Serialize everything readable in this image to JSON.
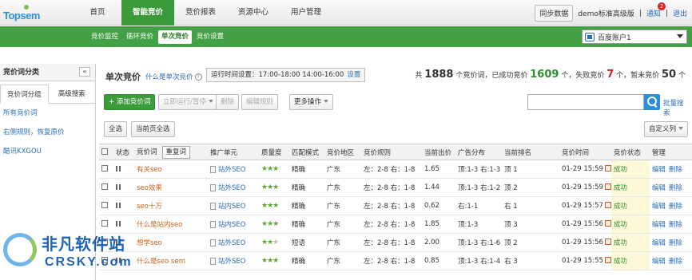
{
  "app": {
    "logo_text": "Topsem"
  },
  "nav": {
    "items": [
      "首页",
      "智能竞价",
      "竞价报表",
      "资源中心",
      "用户管理"
    ],
    "active_index": 1
  },
  "topright": {
    "sync_label": "同步数据",
    "user_label": "demo标准高级版",
    "notice_label": "通知",
    "notice_count": "2",
    "logout_label": "退出"
  },
  "subnav": {
    "items": [
      "竞价监控",
      "循环竞价",
      "单次竞价",
      "竞价设置"
    ],
    "active_index": 2
  },
  "account_select": {
    "value": "百度账户1"
  },
  "sidebar": {
    "title": "竞价词分类",
    "collapse_glyph": "«",
    "tabs": [
      "竞价词分组",
      "高级搜索"
    ],
    "links": [
      "所有竞价词",
      "右侧规则，恢复原价",
      "酷讯KXGOU"
    ]
  },
  "main": {
    "title": "单次竞价",
    "what_link": "什么是单次竞价",
    "info_glyph": "?",
    "time_label": "运行时间设置：17:00-18:00 14:00-16:00",
    "time_setting": "设置",
    "stats": {
      "prefix": "共",
      "total": "1888",
      "t1": "个竞价词，已成功竞价",
      "success": "1609",
      "t2": "个，失败竞价",
      "fail": "7",
      "t3": "个，暂未竞价",
      "pending": "50",
      "t4": "个"
    }
  },
  "toolbar": {
    "add_label": "+ 添加竞价词",
    "run_label": "立即运行/暂停",
    "delete_label": "删除",
    "edit_rule_label": "编辑规则",
    "more_label": "更多操作",
    "search_placeholder": "",
    "adv_search_label": "批量搜索"
  },
  "toolbar2": {
    "select_all": "全选",
    "select_page": "当前页全选",
    "custom_cols": "自定义列"
  },
  "table": {
    "headers": [
      "状态",
      "竞价词",
      "重复词",
      "推广单元",
      "质量度",
      "匹配模式",
      "竞价地区",
      "竞价规则",
      "当前出价",
      "广告分布",
      "当前排名",
      "竞价时间",
      "竞价状态",
      "管理"
    ],
    "rows": [
      {
        "keyword": "有关seo",
        "unit": "站外SEO",
        "stars": 3,
        "match": "精确",
        "region": "广东",
        "rule": "左：2-8 右：1-8",
        "price": "1.65",
        "dist": "顶:1-3 右:1-3",
        "rank": "顶 1",
        "time": "01-29 15:59",
        "status": "成功",
        "edit": "编辑",
        "del": "删除"
      },
      {
        "keyword": "seo效果",
        "unit": "站外SEO",
        "stars": 3,
        "match": "精确",
        "region": "广东",
        "rule": "左：2-8 右：1-8",
        "price": "1.44",
        "dist": "顶:1-3 右:1-2",
        "rank": "顶 2",
        "time": "01-29 15:59",
        "status": "成功",
        "edit": "编辑",
        "del": "删除"
      },
      {
        "keyword": "seo十万",
        "unit": "站内SEO",
        "stars": 3,
        "match": "精确",
        "region": "广东",
        "rule": "左：2-8 右：1-8",
        "price": "0.62",
        "dist": "右:1-1",
        "rank": "右 1",
        "time": "01-29 15:57",
        "status": "成功",
        "edit": "编辑",
        "del": "删除"
      },
      {
        "keyword": "什么是站内seo",
        "unit": "站内SEO",
        "stars": 3,
        "match": "精确",
        "region": "广东",
        "rule": "左：2-8 右：1-8",
        "price": "1.85",
        "dist": "顶:1-3",
        "rank": "顶 3",
        "time": "01-29 15:56",
        "status": "成功",
        "edit": "编辑",
        "del": "删除"
      },
      {
        "keyword": "想学seo",
        "unit": "站外SEO",
        "stars": 2,
        "match": "短语",
        "region": "广东",
        "rule": "左：2-8 右：1-8",
        "price": "2.00",
        "dist": "顶:1-3 右:1-6",
        "rank": "顶 2",
        "time": "01-29 15:56",
        "status": "成功",
        "edit": "编辑",
        "del": "删除"
      },
      {
        "keyword": "什么是seo sem",
        "unit": "站外SEO",
        "stars": 3,
        "match": "精确",
        "region": "广东",
        "rule": "左：2-8 右：1-8",
        "price": "0.85",
        "dist": "顶:1-3 右:1-4",
        "rank": "右 3",
        "time": "01-29 15:55",
        "status": "成功",
        "edit": "编辑",
        "del": "删除"
      }
    ]
  },
  "watermark": {
    "cn": "非凡软件站",
    "en": "CRSKY.com"
  },
  "colors": {
    "green": "#44a044",
    "link": "#2a6eb8",
    "keyword": "#d0621c",
    "success": "#2c8f2c",
    "fail": "#d02020"
  }
}
